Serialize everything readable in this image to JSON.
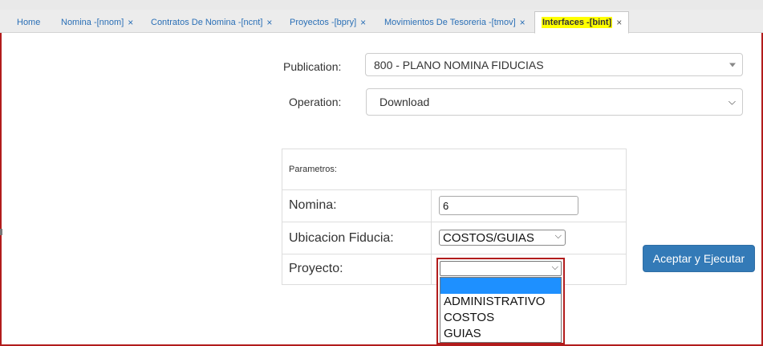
{
  "tabs": [
    {
      "label": "Home",
      "closable": false
    },
    {
      "label": "Nomina -[nnom]",
      "closable": true
    },
    {
      "label": "Contratos De Nomina -[ncnt]",
      "closable": true
    },
    {
      "label": "Proyectos -[bpry]",
      "closable": true
    },
    {
      "label": "Movimientos De Tesoreria -[tmov]",
      "closable": true
    },
    {
      "label": "Interfaces -[bint]",
      "closable": true,
      "active": true
    }
  ],
  "close_glyph": "×",
  "form": {
    "publication_label": "Publication:",
    "publication_value": "800 - PLANO NOMINA FIDUCIAS",
    "operation_label": "Operation:",
    "operation_value": "Download"
  },
  "params": {
    "title": "Parametros:",
    "nomina_label": "Nomina:",
    "nomina_value": "6",
    "ubicacion_label": "Ubicacion Fiducia:",
    "ubicacion_value": "COSTOS/GUIAS",
    "proyecto_label": "Proyecto:",
    "proyecto_value": "",
    "proyecto_options": [
      "",
      "ADMINISTRATIVO",
      "COSTOS",
      "GUIAS"
    ],
    "proyecto_highlighted_index": 0
  },
  "execute_button": "Aceptar y Ejecutar",
  "colors": {
    "tab_text": "#2a6fb6",
    "active_tab_highlight": "#ffff00",
    "outline_red": "#b21c1c",
    "button_blue": "#337ab7",
    "option_highlight": "#1e90ff"
  },
  "icons": {
    "tab_close": "close-icon",
    "select_caret": "caret-down-icon",
    "select_chevron": "chevron-down-icon"
  }
}
